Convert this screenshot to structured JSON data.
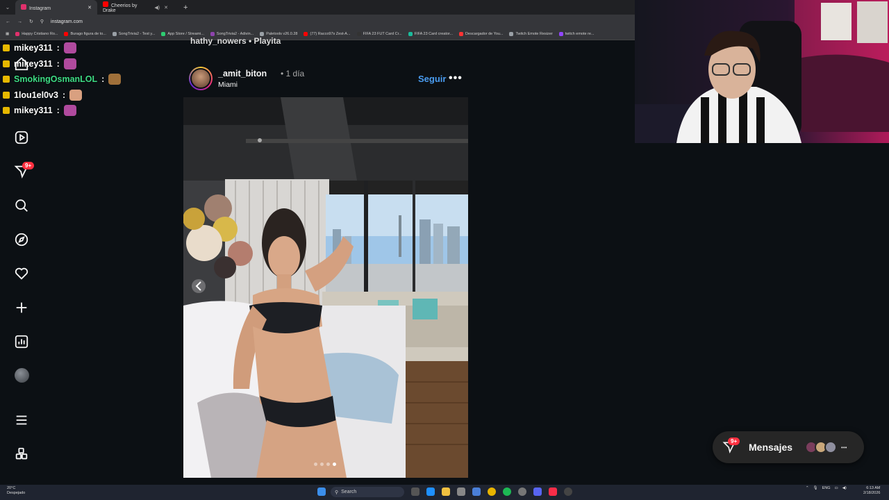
{
  "browser": {
    "tabs": [
      {
        "title": "Instagram",
        "active": true,
        "favicon_color": "#e1306c"
      },
      {
        "title": "Cheerios by Drake",
        "active": false,
        "favicon_color": "#ff0000"
      }
    ],
    "new_tab_label": "+",
    "url": "instagram.com",
    "bookmarks": [
      {
        "label": "Happy Cristiano Ro...",
        "color": "#e1306c"
      },
      {
        "label": "Burago figura de to...",
        "color": "#ff0000"
      },
      {
        "label": "SongTrivia2 - Test y...",
        "color": "#9aa0a6"
      },
      {
        "label": "App Store / Streami...",
        "color": "#2ecc71"
      },
      {
        "label": "SongTrivia2 - Adivin...",
        "color": "#8e44ad"
      },
      {
        "label": "Paletools v26.0.28",
        "color": "#9aa0a6"
      },
      {
        "label": "(77) Racco97s Zest-A...",
        "color": "#ff0000"
      },
      {
        "label": "FIFA 23 FUT Card Cr...",
        "color": "#333333"
      },
      {
        "label": "FIFA 23 Card creator...",
        "color": "#1abc9c"
      },
      {
        "label": "Descargador de You...",
        "color": "#ff3333"
      },
      {
        "label": "Twitch Emote Resizer",
        "color": "#9aa0a6"
      },
      {
        "label": "twitch emote re...",
        "color": "#9146ff"
      }
    ]
  },
  "chat": [
    {
      "user": "mikey311",
      "color": "#ffffff",
      "emote_color": "#b04a9e"
    },
    {
      "user": "mikey311",
      "color": "#ffffff",
      "emote_color": "#b04a9e"
    },
    {
      "user": "SmokingOsmanLOL",
      "color": "#3ddc84",
      "emote_color": "#a0703a"
    },
    {
      "user": "1lou1el0v3",
      "color": "#ffffff",
      "emote_color": "#d9a080"
    },
    {
      "user": "mikey311",
      "color": "#ffffff",
      "emote_color": "#b04a9e"
    }
  ],
  "chat_separator": ":",
  "sidebar": {
    "items": [
      {
        "icon": "home-icon"
      },
      {
        "icon": "reels-icon"
      },
      {
        "icon": "notifications-icon"
      },
      {
        "icon": "search-icon"
      },
      {
        "icon": "explore-icon"
      },
      {
        "icon": "heart-icon"
      },
      {
        "icon": "create-icon"
      },
      {
        "icon": "dashboard-icon"
      },
      {
        "icon": "profile-avatar"
      },
      {
        "icon": "menu-icon"
      },
      {
        "icon": "more-apps-icon"
      }
    ],
    "notification_badge": "9+"
  },
  "feed": {
    "partial_previous": "hathy_nowers • Playita",
    "post": {
      "username": "_amit_biton",
      "time": "• 1 día",
      "location": "Miami",
      "follow_label": "Seguir",
      "more_label": "•••",
      "carousel_count": 4,
      "carousel_active": 3
    }
  },
  "messages": {
    "label": "Mensajes",
    "badge": "9+",
    "more_label": "•••",
    "avatar_colors": [
      "#7a3d5c",
      "#c9a77a",
      "#8f8f9f"
    ]
  },
  "taskbar": {
    "weather_temp": "20°C",
    "weather_desc": "Despejado",
    "search_label": "Search",
    "language": "ENG",
    "time": "6:13 AM",
    "date": "2/18/2026"
  }
}
